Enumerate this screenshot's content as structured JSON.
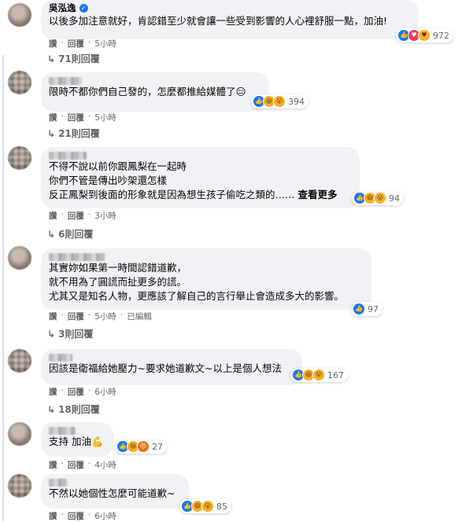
{
  "comments": [
    {
      "author": "吳泓逸",
      "verified": true,
      "text": "以後多加注意就好，肯認錯至少就會讓一些受到影響的人心裡舒服一點，加油!",
      "reaction_count": "972",
      "reactions": [
        "like-icon",
        "love-icon",
        "care-icon"
      ],
      "like_label": "讚",
      "reply_label": "回覆",
      "time": "5小時",
      "replies_label": "71則回覆"
    },
    {
      "author": "",
      "text": "限時不都你們自己發的，怎麼都推給媒體了😑",
      "reaction_count": "394",
      "reactions": [
        "like-icon",
        "haha-icon",
        "wow-icon"
      ],
      "like_label": "讚",
      "reply_label": "回覆",
      "time": "5小時",
      "replies_label": "21則回覆"
    },
    {
      "author": "",
      "text": "不得不說以前你跟鳳梨在一起時\n你們不管是傳出吵架還怎樣\n反正鳳梨到後面的形象就是因為想生孩子偷吃之類的……",
      "see_more": "查看更多",
      "reaction_count": "94",
      "reactions": [
        "like-icon",
        "haha-icon",
        "wow-icon"
      ],
      "like_label": "讚",
      "reply_label": "回覆",
      "time": "3小時",
      "replies_label": "6則回覆"
    },
    {
      "author": "",
      "text": "其實妳如果第一時間認錯道歉，\n就不用為了圓謊而扯更多的謊。\n尤其又是知名人物，更應該了解自己的言行舉止會造成多大的影響。",
      "reaction_count": "97",
      "reactions": [
        "like-icon"
      ],
      "like_label": "讚",
      "reply_label": "回覆",
      "time": "5小時",
      "edited": "已編輯",
      "replies_label": "3則回覆"
    },
    {
      "author": "",
      "text": "因該是衛福給她壓力~要求她道歉文~以上是個人想法",
      "reaction_count": "167",
      "reactions": [
        "like-icon",
        "haha-icon",
        "wow-icon"
      ],
      "like_label": "讚",
      "reply_label": "回覆",
      "time": "6小時",
      "replies_label": "18則回覆"
    },
    {
      "author": "",
      "text": "支持 加油💪",
      "reaction_count": "27",
      "reactions": [
        "like-icon",
        "haha-icon",
        "angry-icon"
      ],
      "like_label": "讚",
      "reply_label": "回覆",
      "time": "4小時"
    },
    {
      "author": "",
      "text": "不然以她個性怎麼可能道歉~",
      "reaction_count": "85",
      "reactions": [
        "like-icon",
        "haha-icon",
        "wow-icon"
      ],
      "like_label": "讚",
      "reply_label": "回覆",
      "time": "6小時"
    }
  ]
}
